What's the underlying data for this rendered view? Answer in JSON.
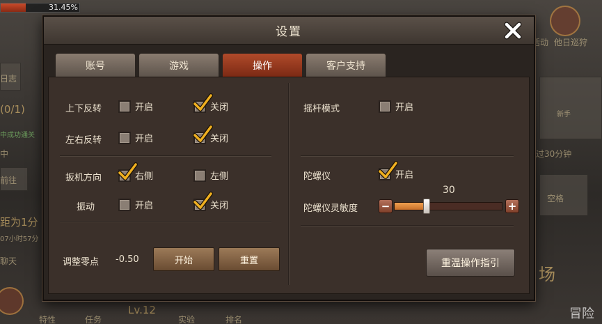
{
  "background": {
    "progress_text": "31.45%",
    "progress_value": 0.3145,
    "left_texts": [
      "日志",
      "(0/1)",
      "中成功通关",
      "中",
      "前往",
      "距为1分",
      "07小时57分",
      "聊天"
    ],
    "right_texts": [
      "活动",
      "他日巡狩",
      "新手",
      "过30分钟",
      "空格",
      "场",
      "冒险"
    ],
    "bottom_texts": [
      "特性",
      "任务",
      "Lv.12",
      "实验",
      "排名"
    ]
  },
  "dialog": {
    "title": "设置",
    "tabs": [
      {
        "label": "账号",
        "active": false
      },
      {
        "label": "游戏",
        "active": false
      },
      {
        "label": "操作",
        "active": true
      },
      {
        "label": "客户支持",
        "active": false
      }
    ],
    "left": {
      "invert_vertical": {
        "label": "上下反转",
        "on_label": "开启",
        "off_label": "关闭",
        "on_checked": false,
        "off_checked": true
      },
      "invert_horizontal": {
        "label": "左右反转",
        "on_label": "开启",
        "off_label": "关闭",
        "on_checked": false,
        "off_checked": true
      },
      "trigger_direction": {
        "label": "扳机方向",
        "right_label": "右侧",
        "left_label": "左侧",
        "right_checked": true,
        "left_checked": false
      },
      "vibration": {
        "label": "振动",
        "on_label": "开启",
        "off_label": "关闭",
        "on_checked": false,
        "off_checked": true
      },
      "zero_point": {
        "label": "调整零点",
        "value": "-0.50",
        "start_label": "开始",
        "reset_label": "重置"
      }
    },
    "right": {
      "joystick_mode": {
        "label": "摇杆模式",
        "on_label": "开启",
        "on_checked": false
      },
      "gyroscope": {
        "label": "陀螺仪",
        "on_label": "开启",
        "on_checked": true
      },
      "gyro_sensitivity": {
        "label": "陀螺仪灵敏度",
        "value": "30",
        "fraction": 0.3,
        "minus": "−",
        "plus": "+"
      },
      "tutorial_button": "重温操作指引"
    }
  },
  "colors": {
    "accent_tab": "#b04a2a",
    "check": "#f0b020",
    "slider_fill": "#e08a3a"
  }
}
